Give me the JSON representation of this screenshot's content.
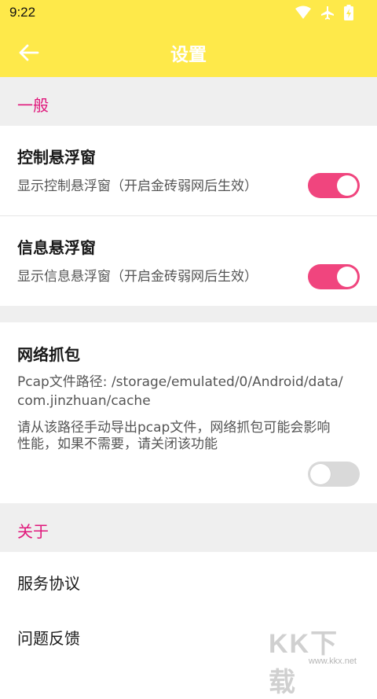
{
  "status_bar": {
    "time": "9:22"
  },
  "app_bar": {
    "title": "设置"
  },
  "sections": {
    "general": "一般",
    "about": "关于"
  },
  "settings": {
    "control_float": {
      "title": "控制悬浮窗",
      "desc": "显示控制悬浮窗（开启金砖弱网后生效）",
      "enabled": true
    },
    "info_float": {
      "title": "信息悬浮窗",
      "desc": "显示信息悬浮窗（开启金砖弱网后生效）",
      "enabled": true
    },
    "packet_capture": {
      "title": "网络抓包",
      "path_line1": "Pcap文件路径: /storage/emulated/0/Android/data/",
      "path_line2": "com.jinzhuan/cache",
      "note_line1": "请从该路径手动导出pcap文件，网络抓包可能会影响",
      "note_line2": "性能，如果不需要，请关闭该功能",
      "enabled": false
    }
  },
  "about_items": {
    "service_agreement": "服务协议",
    "feedback": "问题反馈"
  },
  "watermark": {
    "big": "KK下载",
    "small": "www.kkx.net"
  },
  "colors": {
    "app_bar": "#fee94a",
    "accent": "#e0177b",
    "toggle_on": "#f0457e",
    "toggle_off": "#d9d9d9"
  }
}
